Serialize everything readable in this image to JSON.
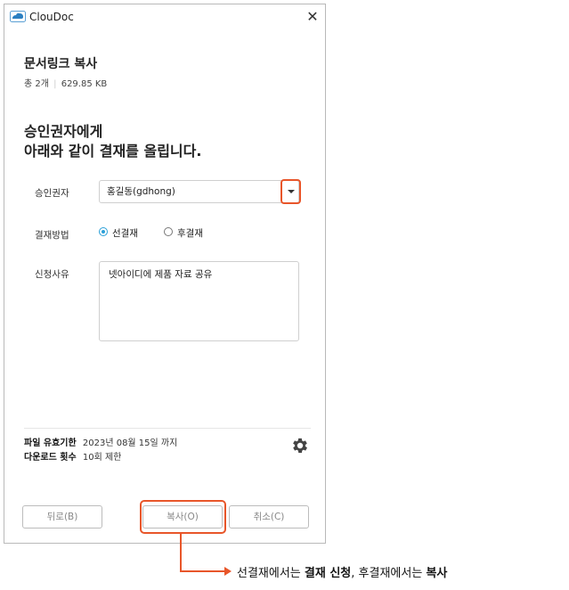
{
  "window": {
    "title": "ClouDoc",
    "close_glyph": "✕"
  },
  "header": {
    "title": "문서링크 복사",
    "count": "총 2개",
    "separator": "|",
    "size": "629.85 KB"
  },
  "message": {
    "line1": "승인권자에게",
    "line2": "아래와 같이 결재를 올립니다."
  },
  "form": {
    "approver_label": "승인권자",
    "approver_value": "홍길동(gdhong)",
    "method_label": "결재방법",
    "method_options": [
      {
        "label": "선결재",
        "selected": true
      },
      {
        "label": "후결재",
        "selected": false
      }
    ],
    "reason_label": "신청사유",
    "reason_value": "넷아이디에 제품 자료 공유"
  },
  "footer_info": {
    "expiry_label": "파일 유효기한",
    "expiry_value": "2023년 08월 15일 까지",
    "download_label": "다운로드 횟수",
    "download_value": "10회 제한"
  },
  "buttons": {
    "back": "뒤로(B)",
    "copy": "복사(O)",
    "cancel": "취소(C)"
  },
  "annotation": {
    "part1": "선결재에서는 ",
    "bold1": "결재 신청",
    "part2": ", 후결재에서는 ",
    "bold2": "복사"
  },
  "colors": {
    "accent": "#e8562a",
    "radio": "#2ba0d8"
  }
}
